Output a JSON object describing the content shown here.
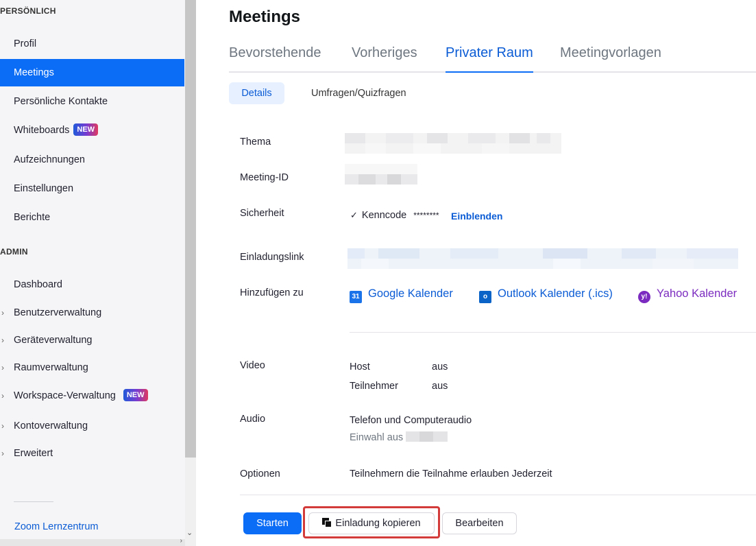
{
  "sidebar": {
    "section_personal": "PERSÖNLICH",
    "personal_items": [
      {
        "label": "Profil"
      },
      {
        "label": "Meetings"
      },
      {
        "label": "Persönliche Kontakte"
      },
      {
        "label": "Whiteboards",
        "badge": "NEW"
      },
      {
        "label": "Aufzeichnungen"
      },
      {
        "label": "Einstellungen"
      },
      {
        "label": "Berichte"
      }
    ],
    "active_item": "Meetings",
    "section_admin": "ADMIN",
    "admin_items": [
      {
        "label": "Dashboard"
      },
      {
        "label": "Benutzerverwaltung"
      },
      {
        "label": "Geräteverwaltung"
      },
      {
        "label": "Raumverwaltung"
      },
      {
        "label": "Workspace-Verwaltung",
        "badge": "NEW"
      },
      {
        "label": "Kontoverwaltung"
      },
      {
        "label": "Erweitert"
      }
    ],
    "footer_link": "Zoom Lernzentrum"
  },
  "main": {
    "title": "Meetings",
    "tabs": [
      {
        "label": "Bevorstehende"
      },
      {
        "label": "Vorheriges"
      },
      {
        "label": "Privater Raum"
      },
      {
        "label": "Meetingvorlagen"
      }
    ],
    "active_tab": "Privater Raum",
    "subtabs": [
      {
        "label": "Details"
      },
      {
        "label": "Umfragen/Quizfragen"
      }
    ],
    "details": {
      "topic_label": "Thema",
      "meeting_id_label": "Meeting-ID",
      "security_label": "Sicherheit",
      "passcode_label": "Kenncode",
      "passcode_masked": "********",
      "show_link": "Einblenden",
      "invite_link_label": "Einladungslink",
      "add_to_label": "Hinzufügen zu",
      "calendars": [
        {
          "label": "Google Kalender",
          "icon": "google-calendar-icon",
          "color": "#0b5cd5"
        },
        {
          "label": "Outlook Kalender (.ics)",
          "icon": "outlook-icon",
          "color": "#0b5cd5"
        },
        {
          "label": "Yahoo Kalender",
          "icon": "yahoo-icon",
          "color": "#7b2bbf"
        }
      ],
      "video_label": "Video",
      "video_host_label": "Host",
      "video_host_value": "aus",
      "video_participant_label": "Teilnehmer",
      "video_participant_value": "aus",
      "audio_label": "Audio",
      "audio_value": "Telefon und Computeraudio",
      "dial_in_label": "Einwahl aus",
      "options_label": "Optionen",
      "options_value": "Teilnehmern die Teilnahme erlauben Jederzeit"
    },
    "buttons": {
      "start": "Starten",
      "copy_invite": "Einladung kopieren",
      "edit": "Bearbeiten"
    }
  },
  "colors": {
    "accent": "#0b6cf5",
    "link": "#0b5cd5",
    "highlight_box": "#d33a3a",
    "yahoo": "#7b2bbf"
  }
}
